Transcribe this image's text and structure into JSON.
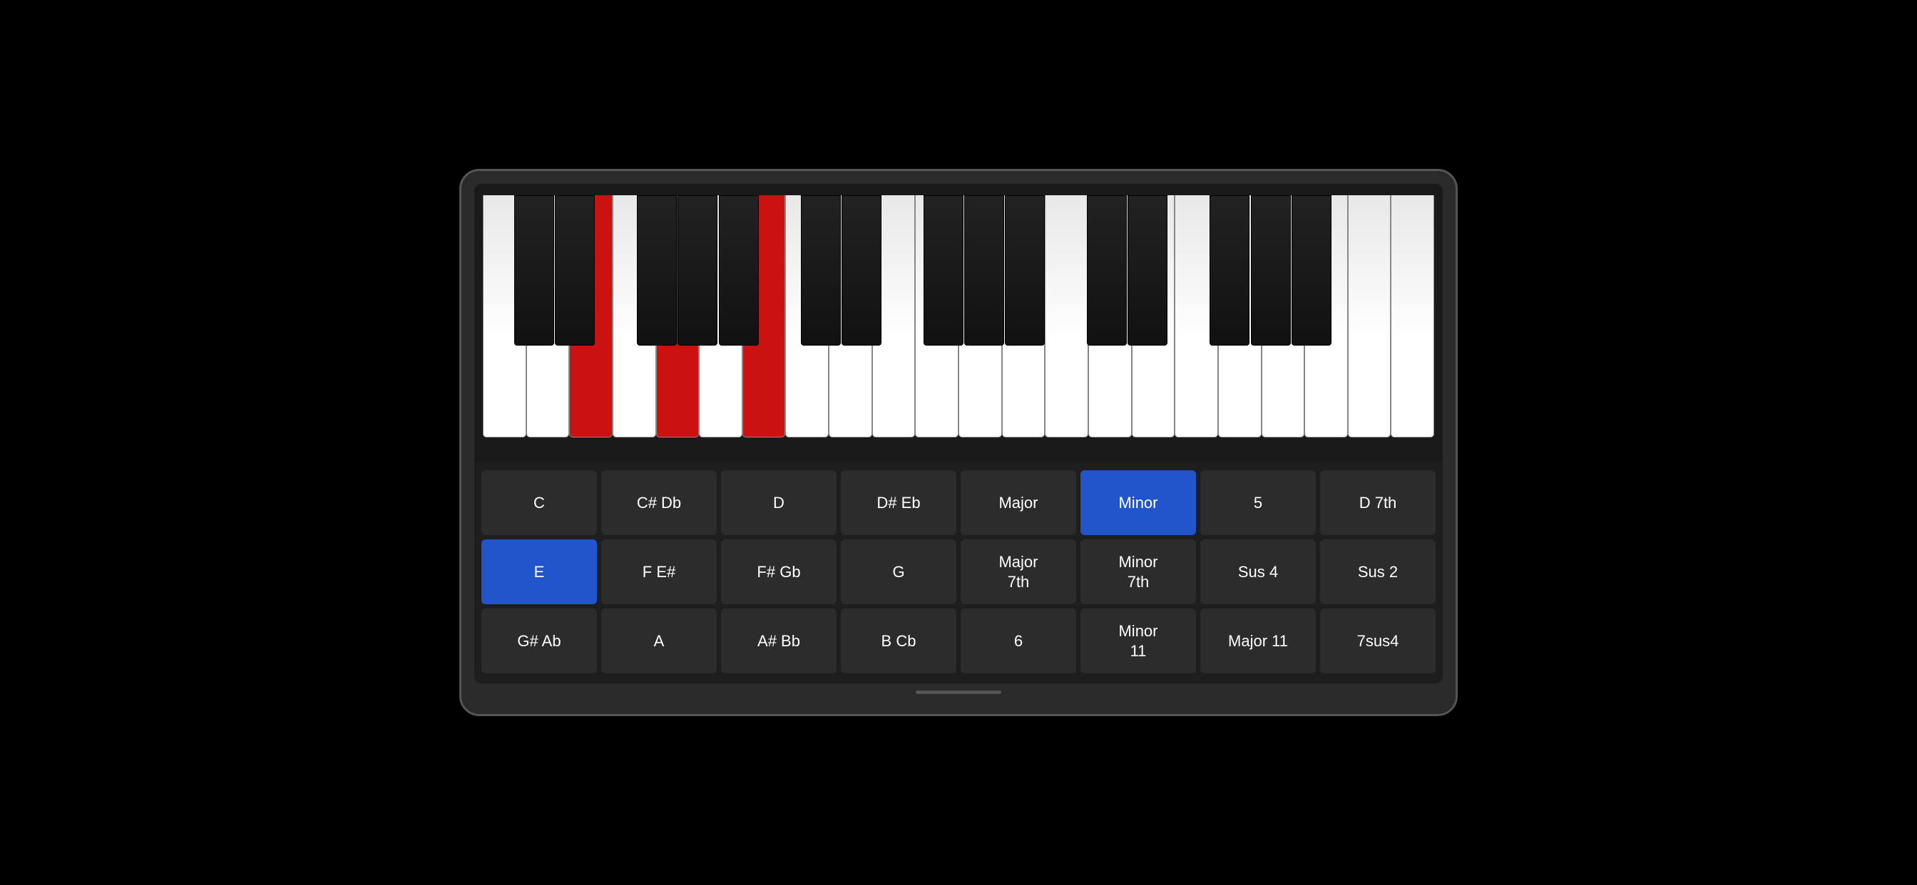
{
  "piano": {
    "white_keys": [
      {
        "note": "C",
        "active": false
      },
      {
        "note": "D",
        "active": false
      },
      {
        "note": "E",
        "active": true
      },
      {
        "note": "F",
        "active": false
      },
      {
        "note": "G",
        "active": true
      },
      {
        "note": "A",
        "active": false
      },
      {
        "note": "B",
        "active": true
      },
      {
        "note": "C2",
        "active": false
      },
      {
        "note": "D2",
        "active": false
      },
      {
        "note": "E2",
        "active": false
      },
      {
        "note": "F2",
        "active": false
      },
      {
        "note": "G2",
        "active": false
      },
      {
        "note": "A2",
        "active": false
      },
      {
        "note": "B2",
        "active": false
      },
      {
        "note": "C3",
        "active": false
      },
      {
        "note": "D3",
        "active": false
      },
      {
        "note": "E3",
        "active": false
      },
      {
        "note": "F3",
        "active": false
      },
      {
        "note": "G3",
        "active": false
      },
      {
        "note": "A3",
        "active": false
      },
      {
        "note": "B3",
        "active": false
      },
      {
        "note": "C4",
        "active": false
      }
    ],
    "black_keys": [
      {
        "note": "C#",
        "active": false,
        "left_pct": 3.3
      },
      {
        "note": "D#",
        "active": false,
        "left_pct": 7.6
      },
      {
        "note": "F#",
        "active": false,
        "left_pct": 16.2
      },
      {
        "note": "G#",
        "active": false,
        "left_pct": 20.5
      },
      {
        "note": "A#",
        "active": false,
        "left_pct": 24.8
      },
      {
        "note": "C#2",
        "active": false,
        "left_pct": 33.4
      },
      {
        "note": "D#2",
        "active": false,
        "left_pct": 37.7
      },
      {
        "note": "F#2",
        "active": false,
        "left_pct": 46.3
      },
      {
        "note": "G#2",
        "active": false,
        "left_pct": 50.6
      },
      {
        "note": "A#2",
        "active": false,
        "left_pct": 54.9
      },
      {
        "note": "C#3",
        "active": false,
        "left_pct": 63.5
      },
      {
        "note": "D#3",
        "active": false,
        "left_pct": 67.8
      },
      {
        "note": "F#3",
        "active": false,
        "left_pct": 76.4
      },
      {
        "note": "G#3",
        "active": false,
        "left_pct": 80.7
      },
      {
        "note": "A#3",
        "active": false,
        "left_pct": 85.0
      }
    ]
  },
  "buttons": {
    "rows": [
      [
        {
          "label": "C",
          "active": false
        },
        {
          "label": "C# Db",
          "active": false
        },
        {
          "label": "D",
          "active": false
        },
        {
          "label": "D# Eb",
          "active": false
        },
        {
          "label": "Major",
          "active": false
        },
        {
          "label": "Minor",
          "active": true
        },
        {
          "label": "5",
          "active": false
        },
        {
          "label": "D 7th",
          "active": false
        }
      ],
      [
        {
          "label": "E",
          "active": true
        },
        {
          "label": "F E#",
          "active": false
        },
        {
          "label": "F# Gb",
          "active": false
        },
        {
          "label": "G",
          "active": false
        },
        {
          "label": "Major\n7th",
          "active": false
        },
        {
          "label": "Minor\n7th",
          "active": false
        },
        {
          "label": "Sus 4",
          "active": false
        },
        {
          "label": "Sus 2",
          "active": false
        }
      ],
      [
        {
          "label": "G# Ab",
          "active": false
        },
        {
          "label": "A",
          "active": false
        },
        {
          "label": "A# Bb",
          "active": false
        },
        {
          "label": "B Cb",
          "active": false
        },
        {
          "label": "6",
          "active": false
        },
        {
          "label": "Minor\n11",
          "active": false
        },
        {
          "label": "Major 11",
          "active": false
        },
        {
          "label": "7sus4",
          "active": false
        }
      ]
    ]
  }
}
